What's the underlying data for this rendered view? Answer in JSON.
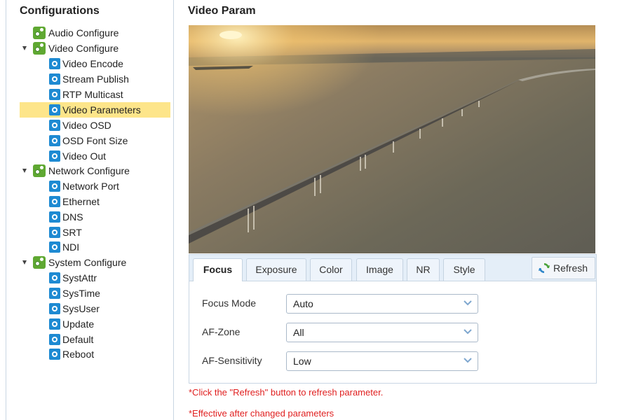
{
  "left_panel": {
    "title": "Configurations",
    "groups": [
      {
        "label": "Audio Configure",
        "children": []
      },
      {
        "label": "Video Configure",
        "children": [
          "Video Encode",
          "Stream Publish",
          "RTP Multicast",
          "Video Parameters",
          "Video OSD",
          "OSD Font Size",
          "Video Out"
        ]
      },
      {
        "label": "Network Configure",
        "children": [
          "Network Port",
          "Ethernet",
          "DNS",
          "SRT",
          "NDI"
        ]
      },
      {
        "label": "System Configure",
        "children": [
          "SystAttr",
          "SysTime",
          "SysUser",
          "Update",
          "Default",
          "Reboot"
        ]
      }
    ],
    "selected": "Video Parameters"
  },
  "main": {
    "title": "Video Param",
    "tabs": [
      "Focus",
      "Exposure",
      "Color",
      "Image",
      "NR",
      "Style"
    ],
    "active_tab": "Focus",
    "refresh_label": "Refresh",
    "fields": [
      {
        "label": "Focus Mode",
        "value": "Auto"
      },
      {
        "label": "AF-Zone",
        "value": "All"
      },
      {
        "label": "AF-Sensitivity",
        "value": "Low"
      }
    ],
    "notes": [
      "*Click the \"Refresh\" button to refresh parameter.",
      "*Effective after changed parameters"
    ]
  },
  "colors": {
    "selected_bg": "#fde58a",
    "note_red": "#e02020",
    "tab_bar_bg": "#e4eef8",
    "green_icon": "#5fa832",
    "blue_icon": "#1e8ad2"
  }
}
